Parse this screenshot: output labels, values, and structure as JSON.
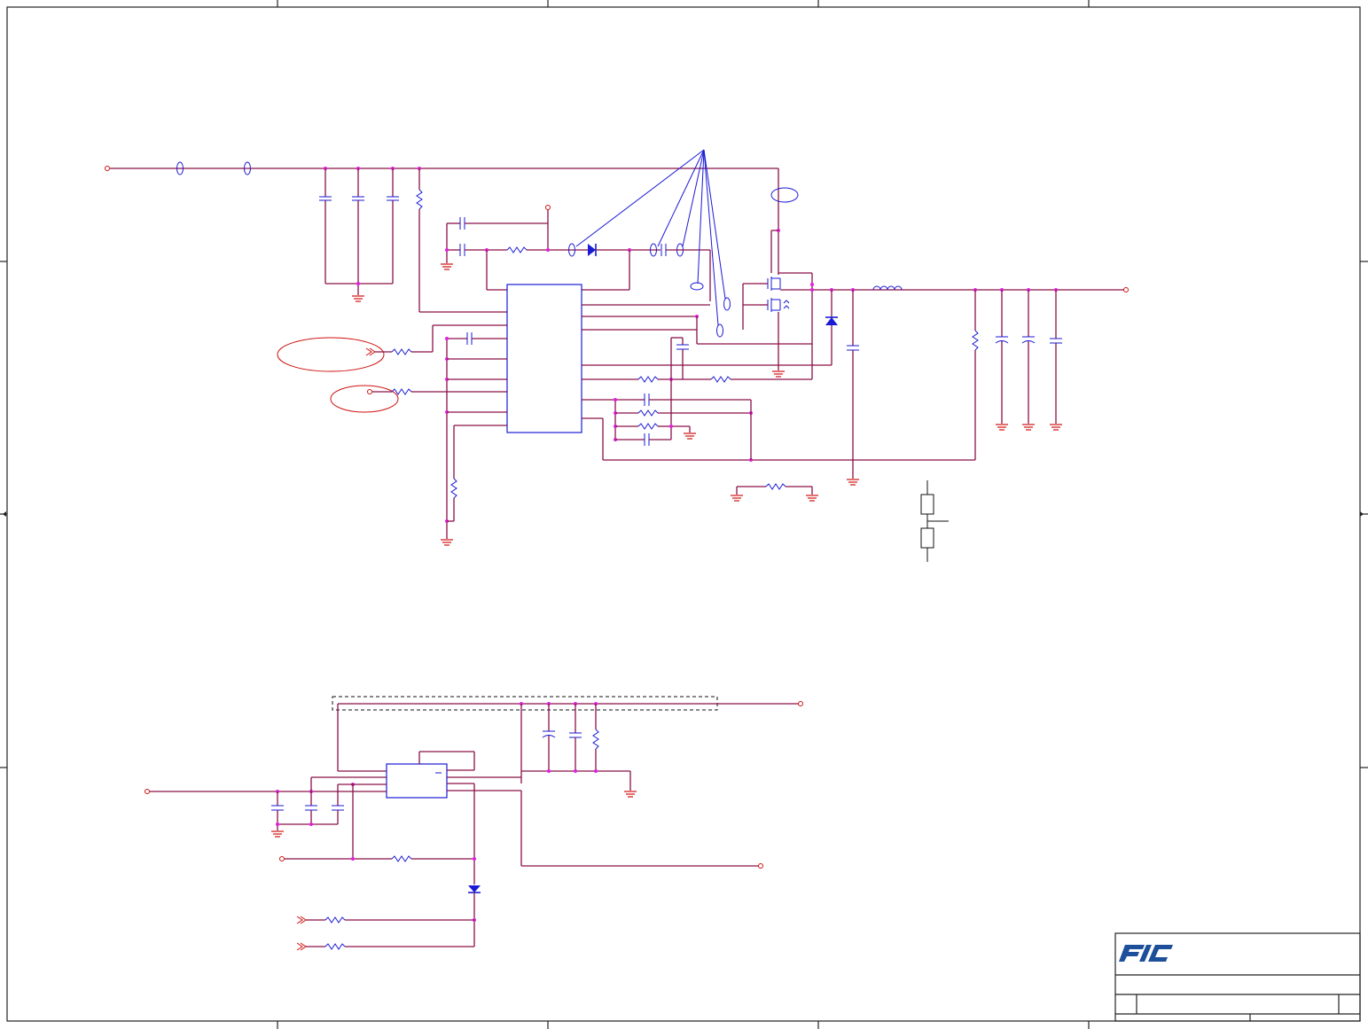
{
  "logo": {
    "text": "FIC",
    "color": "#1e4f9a"
  },
  "colors": {
    "wire": "#8a1048",
    "component": "#1a1ad6",
    "port": "#d01010",
    "junction": "#e020e0",
    "frame": "#222222"
  }
}
